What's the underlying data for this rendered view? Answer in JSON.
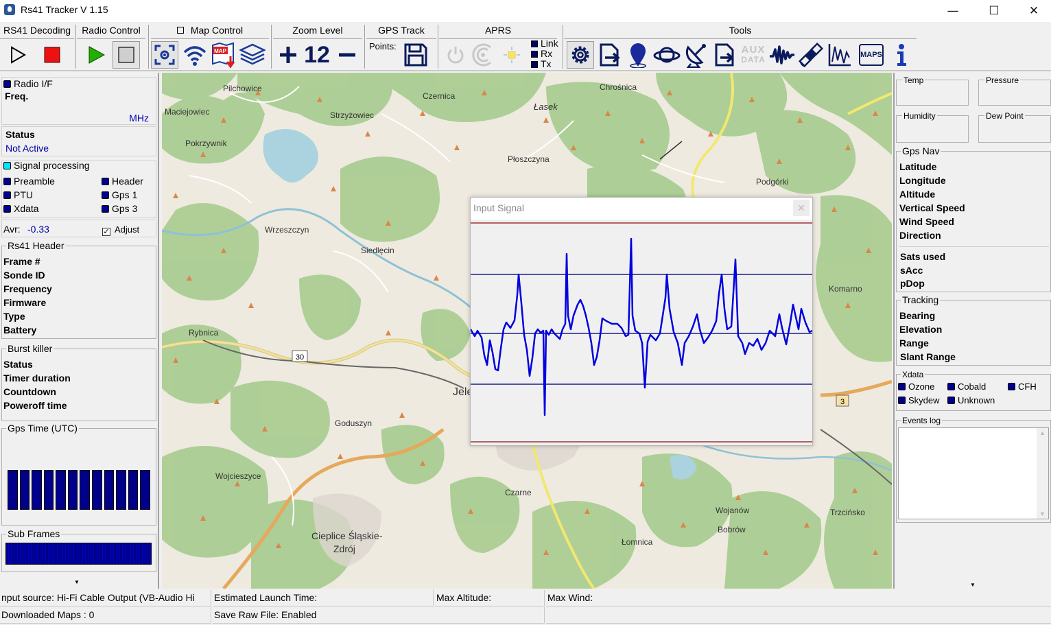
{
  "window": {
    "title": "Rs41 Tracker V 1.15",
    "minimize": "—",
    "maximize": "☐",
    "close": "✕"
  },
  "toolbar": {
    "groups": {
      "rs41_decoding": "RS41 Decoding",
      "radio_control": "Radio Control",
      "map_control": "Map Control",
      "zoom_level": "Zoom Level",
      "gps_track": "GPS Track",
      "aprs": "APRS",
      "tools": "Tools"
    },
    "zoom_value": "12",
    "points_label": "Points:",
    "aprs_legend": [
      "Link",
      "Rx",
      "Tx"
    ],
    "aux_label_top": "AUX",
    "aux_label_bottom": "DATA",
    "maps_label": "MAPS",
    "map_icon_label": "MAP"
  },
  "left": {
    "radio_if": {
      "title": "Radio  I/F",
      "freq_label": "Freq.",
      "freq_unit": "MHz"
    },
    "status": {
      "label": "Status",
      "value": "Not Active"
    },
    "signal_processing": {
      "title": "Signal processing",
      "items": [
        "Preamble",
        "Header",
        "PTU",
        "Gps 1",
        "Xdata",
        "Gps 3"
      ]
    },
    "avr": {
      "label": "Avr:",
      "value": "-0.33",
      "adjust_label": "Adjust",
      "adjust_checked": true
    },
    "rs41_header": {
      "title": "Rs41 Header",
      "fields": [
        "Frame #",
        "Sonde ID",
        "Frequency",
        "Firmware",
        "Type",
        "Battery"
      ]
    },
    "burst_killer": {
      "title": "Burst killer",
      "fields": [
        "Status",
        "Timer duration",
        "Countdown",
        "Poweroff time"
      ]
    },
    "gps_time": {
      "title": "Gps Time (UTC)",
      "bar_count": 12
    },
    "sub_frames": {
      "title": "Sub Frames",
      "segment_count": 51
    }
  },
  "map": {
    "towns": [
      "Pilchowice",
      "Czernica",
      "Chrośnica",
      "Maciejowiec",
      "Strzyżowiec",
      "Łasek",
      "Pokrzywnik",
      "Płoszczyna",
      "Podgórki",
      "Wrzeszczyn",
      "Siedlęcin",
      "Komarno",
      "Rybnica",
      "Jele",
      "Goduszyn",
      "Wojcieszyce",
      "Czarne",
      "Wojanów",
      "Trzcińsko",
      "Cieplice Śląskie-",
      "Zdrój",
      "Bobrów",
      "Łomnica"
    ],
    "road_shields": [
      "30",
      "3"
    ]
  },
  "signal_window": {
    "title": "Input Signal",
    "close": "✕"
  },
  "right": {
    "ptu": {
      "temp": "Temp",
      "pressure": "Pressure",
      "humidity": "Humidity",
      "dew_point": "Dew Point"
    },
    "gps_nav": {
      "title": "Gps Nav",
      "fields": [
        "Latitude",
        "Longitude",
        "Altitude",
        "Vertical Speed",
        "Wind Speed",
        "Direction"
      ],
      "fields2": [
        "Sats used",
        "sAcc",
        "pDop"
      ]
    },
    "tracking": {
      "title": "Tracking",
      "fields": [
        "Bearing",
        "Elevation",
        "Range",
        "Slant Range"
      ]
    },
    "xdata": {
      "title": "Xdata",
      "items": [
        "Ozone",
        "Cobald",
        "CFH",
        "Skydew",
        "Unknown"
      ]
    },
    "events_log": {
      "title": "Events log"
    }
  },
  "statusbar": {
    "input_source": "nput source: Hi-Fi Cable Output (VB-Audio Hi",
    "downloaded_maps": "Downloaded Maps : 0",
    "estimated_launch": "Estimated Launch Time:",
    "save_raw": "Save Raw File: Enabled",
    "max_altitude": "Max Altitude:",
    "max_wind": "Max Wind:"
  },
  "colors": {
    "accent_blue": "#00008b",
    "signal_trace": "#0000e0",
    "guide_line": "#1a1a8c",
    "limit_line": "#a03030",
    "play_green": "#22b000",
    "record_red": "#ee1111"
  }
}
